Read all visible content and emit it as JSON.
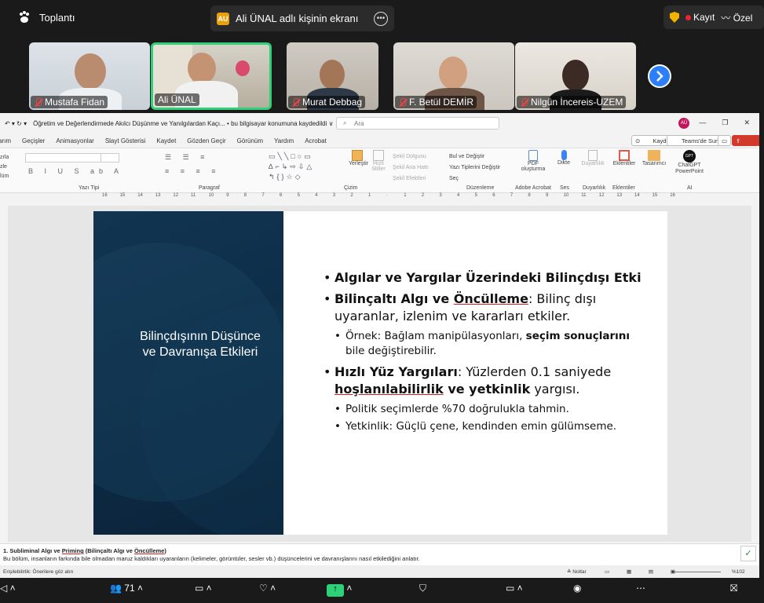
{
  "meeting": {
    "title": "Toplantı",
    "share_label": "Ali ÜNAL adlı kişinin ekranı",
    "share_initials": "AU",
    "record_label": "Kayıt",
    "captions_label": "Özel"
  },
  "participants": [
    {
      "name": "Mustafa Fidan",
      "muted": true
    },
    {
      "name": "Ali ÜNAL",
      "muted": false
    },
    {
      "name": "Murat Debbag",
      "muted": true
    },
    {
      "name": "F. Betül DEMİR",
      "muted": true
    },
    {
      "name": "Nilgün İncereis-UZEM",
      "muted": true
    }
  ],
  "ppt": {
    "doc_title": "Öğretim ve Değerlendirmede Akılcı Düşünme ve Yanılgılardan Kaçı... • bu bilgisayar konumuna kaydedildi ∨",
    "search_placeholder": "Ara",
    "user_initials": "AÜ",
    "menu": [
      "arım",
      "Geçişler",
      "Animasyonlar",
      "Slayt Gösterisi",
      "Kaydet",
      "Gözden Geçir",
      "Görünüm",
      "Yardım",
      "Acrobat"
    ],
    "btn_kaydet": "Kaydet",
    "btn_teams": "Teams'de Sun",
    "btn_share": "Paylaş",
    "ribbon_groups": [
      "Yazı Tipi",
      "Paragraf",
      "Çizim",
      "Düzenleme",
      "Adobe Acrobat",
      "Ses",
      "Duyarlılık",
      "Eklentiler",
      "AI"
    ],
    "ribbon_left": [
      "zrla",
      "zle",
      "lüm"
    ],
    "ribbon_items": {
      "yerlestir": "Yerleştir",
      "hizli": "Hızlı Stiller",
      "sekil_dolgusu": "Şekil Dolgusu",
      "sekil_ana": "Şekil Ana Hattı",
      "sekil_efekt": "Şekil Efektleri",
      "bul": "Bul ve Değiştir",
      "yazi_tip": "Yazı Tiplerini Değiştir",
      "sec": "Seç",
      "pdf": "PDF oluşturma",
      "dikte": "Dikte",
      "duyarlilik": "Duyarlılık",
      "eklentiler": "Eklentiler",
      "tasarimci": "Tasarımcı",
      "chatgpt": "ChatGPT PowerPoint",
      "gpt": "GPT"
    },
    "ruler_left": [
      "16",
      "15",
      "14",
      "13",
      "12",
      "11",
      "10",
      "9",
      "8",
      "7",
      "6",
      "5",
      "4",
      "3",
      "2",
      "1"
    ],
    "ruler_right": [
      "1",
      "2",
      "3",
      "4",
      "5",
      "6",
      "7",
      "8",
      "9",
      "10",
      "11",
      "12",
      "13",
      "14",
      "15",
      "16"
    ],
    "slide": {
      "left_title_1": "Bilinçdışının Düşünce",
      "left_title_2": "ve Davranışa Etkileri",
      "b1": "Algılar ve Yargılar Üzerindeki Bilinçdışı Etki",
      "b2_bold1": "Bilinçaltı Algı ve ",
      "b2_bold2": "Öncülleme",
      "b2_rest": ": Bilinç dışı uyaranlar, izlenim ve kararları etkiler.",
      "b2_sub_pre": "Örnek: Bağlam manipülasyonları, ",
      "b2_sub_bold": "seçim sonuçlarını",
      "b2_sub_post": " bile değiştirebilir.",
      "b3_bold": "Hızlı Yüz Yargıları",
      "b3_mid": ": Yüzlerden 0.1 saniyede ",
      "b3_bold2": "hoşlanılabilirlik",
      "b3_bold3": " ve yetkinlik",
      "b3_end": " yargısı.",
      "b3_sub1": "Politik seçimlerde %70 doğrulukla tahmin.",
      "b3_sub2": "Yetkinlik: Güçlü çene, kendinden emin gülümseme."
    },
    "notes_title_pre": "1. Subliminal Algı ve ",
    "notes_title_u1": "Priming",
    "notes_title_mid": " (Bilinçaltı Algı ve ",
    "notes_title_u2": "Öncülleme",
    "notes_title_end": ")",
    "notes_text": "Bu bölüm, insanların farkında bile olmadan maruz kaldıkları uyaranların (kelimeler, görüntüler, sesler vb.) düşüncelerini ve davranışlarını nasıl etkilediğini anlatır.",
    "status_access": "Erişilebilirlik: Önerilere göz atın",
    "status_notes": "Notlar",
    "status_zoom": "%102"
  },
  "toolbar": {
    "participants_count": "71"
  }
}
